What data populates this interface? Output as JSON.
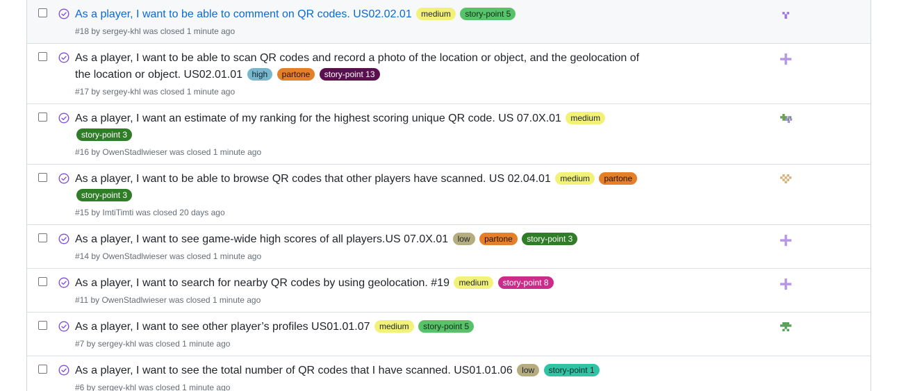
{
  "colors": {
    "closed_icon": "#8250df",
    "link_hover": "#0969da"
  },
  "issues": [
    {
      "title": "As a player, I want to be able to comment on QR codes. US02.02.01",
      "labels": [
        {
          "name": "medium",
          "bg": "#f2f27a",
          "fg": "#1f2328"
        },
        {
          "name": "story-point 5",
          "bg": "#57c26a",
          "fg": "#0f2e16"
        }
      ],
      "meta": "#18 by sergey-khl was closed 1 minute ago",
      "avatar": {
        "icon": "identicon-purple-a",
        "color": "#a070e0"
      }
    },
    {
      "title": "As a player, I want to be able to scan QR codes and record a photo of the location or object, and the geolocation of the location or object. US02.01.01",
      "labels": [
        {
          "name": "high",
          "bg": "#78b6cc",
          "fg": "#0a2733"
        },
        {
          "name": "partone",
          "bg": "#e47f2a",
          "fg": "#2a1100"
        },
        {
          "name": "story-point 13",
          "bg": "#5a0f4e",
          "fg": "#ffffff"
        }
      ],
      "meta": "#17 by sergey-khl was closed 1 minute ago",
      "avatar": {
        "icon": "identicon-purple-b",
        "color": "#b595e6"
      }
    },
    {
      "title": "As a player, I want an estimate of my ranking for the highest scoring unique QR code. US 07.0X.01",
      "labels": [
        {
          "name": "medium",
          "bg": "#f2f27a",
          "fg": "#1f2328"
        },
        {
          "name": "story-point 3",
          "bg": "#2f7d27",
          "fg": "#ffffff"
        }
      ],
      "meta": "#16 by OwenStadlwieser was closed 1 minute ago",
      "avatar": {
        "icon": "identicon-green-purple",
        "color": "#6a9e5a"
      }
    },
    {
      "title": "As a player, I want to be able to browse QR codes that other players have scanned. US 02.04.01",
      "labels": [
        {
          "name": "medium",
          "bg": "#f2f27a",
          "fg": "#1f2328"
        },
        {
          "name": "partone",
          "bg": "#e47f2a",
          "fg": "#2a1100"
        },
        {
          "name": "story-point 3",
          "bg": "#2f7d27",
          "fg": "#ffffff"
        }
      ],
      "meta": "#15 by ImtiTimti was closed 20 days ago",
      "avatar": {
        "icon": "identicon-tan",
        "color": "#d6b07a"
      }
    },
    {
      "title": "As a player, I want to see game-wide high scores of all players.US 07.0X.01",
      "labels": [
        {
          "name": "low",
          "bg": "#b5ad80",
          "fg": "#1f2328"
        },
        {
          "name": "partone",
          "bg": "#e47f2a",
          "fg": "#2a1100"
        },
        {
          "name": "story-point 3",
          "bg": "#2f7d27",
          "fg": "#ffffff"
        }
      ],
      "meta": "#14 by OwenStadlwieser was closed 1 minute ago",
      "avatar": {
        "icon": "identicon-purple-b",
        "color": "#b595e6"
      }
    },
    {
      "title": "As a player, I want to search for nearby QR codes by using geolocation. #19",
      "labels": [
        {
          "name": "medium",
          "bg": "#f2f27a",
          "fg": "#1f2328"
        },
        {
          "name": "story-point 8",
          "bg": "#cc2b8a",
          "fg": "#ffffff"
        }
      ],
      "meta": "#11 by OwenStadlwieser was closed 1 minute ago",
      "avatar": {
        "icon": "identicon-purple-b",
        "color": "#b595e6"
      }
    },
    {
      "title": "As a player, I want to see other player’s profiles US01.01.07",
      "labels": [
        {
          "name": "medium",
          "bg": "#f2f27a",
          "fg": "#1f2328"
        },
        {
          "name": "story-point 5",
          "bg": "#57c26a",
          "fg": "#0f2e16"
        }
      ],
      "meta": "#7 by sergey-khl was closed 1 minute ago",
      "avatar": {
        "icon": "identicon-green",
        "color": "#5aa05a"
      }
    },
    {
      "title": "As a player, I want to see the total number of QR codes that I have scanned. US01.01.06",
      "labels": [
        {
          "name": "low",
          "bg": "#b5ad80",
          "fg": "#1f2328"
        },
        {
          "name": "story-point 1",
          "bg": "#2fc4a4",
          "fg": "#0a2b24"
        }
      ],
      "meta": "#6 by sergey-khl was closed 1 minute ago",
      "avatar": {
        "icon": "identicon-none",
        "color": "#ffffff"
      }
    }
  ]
}
